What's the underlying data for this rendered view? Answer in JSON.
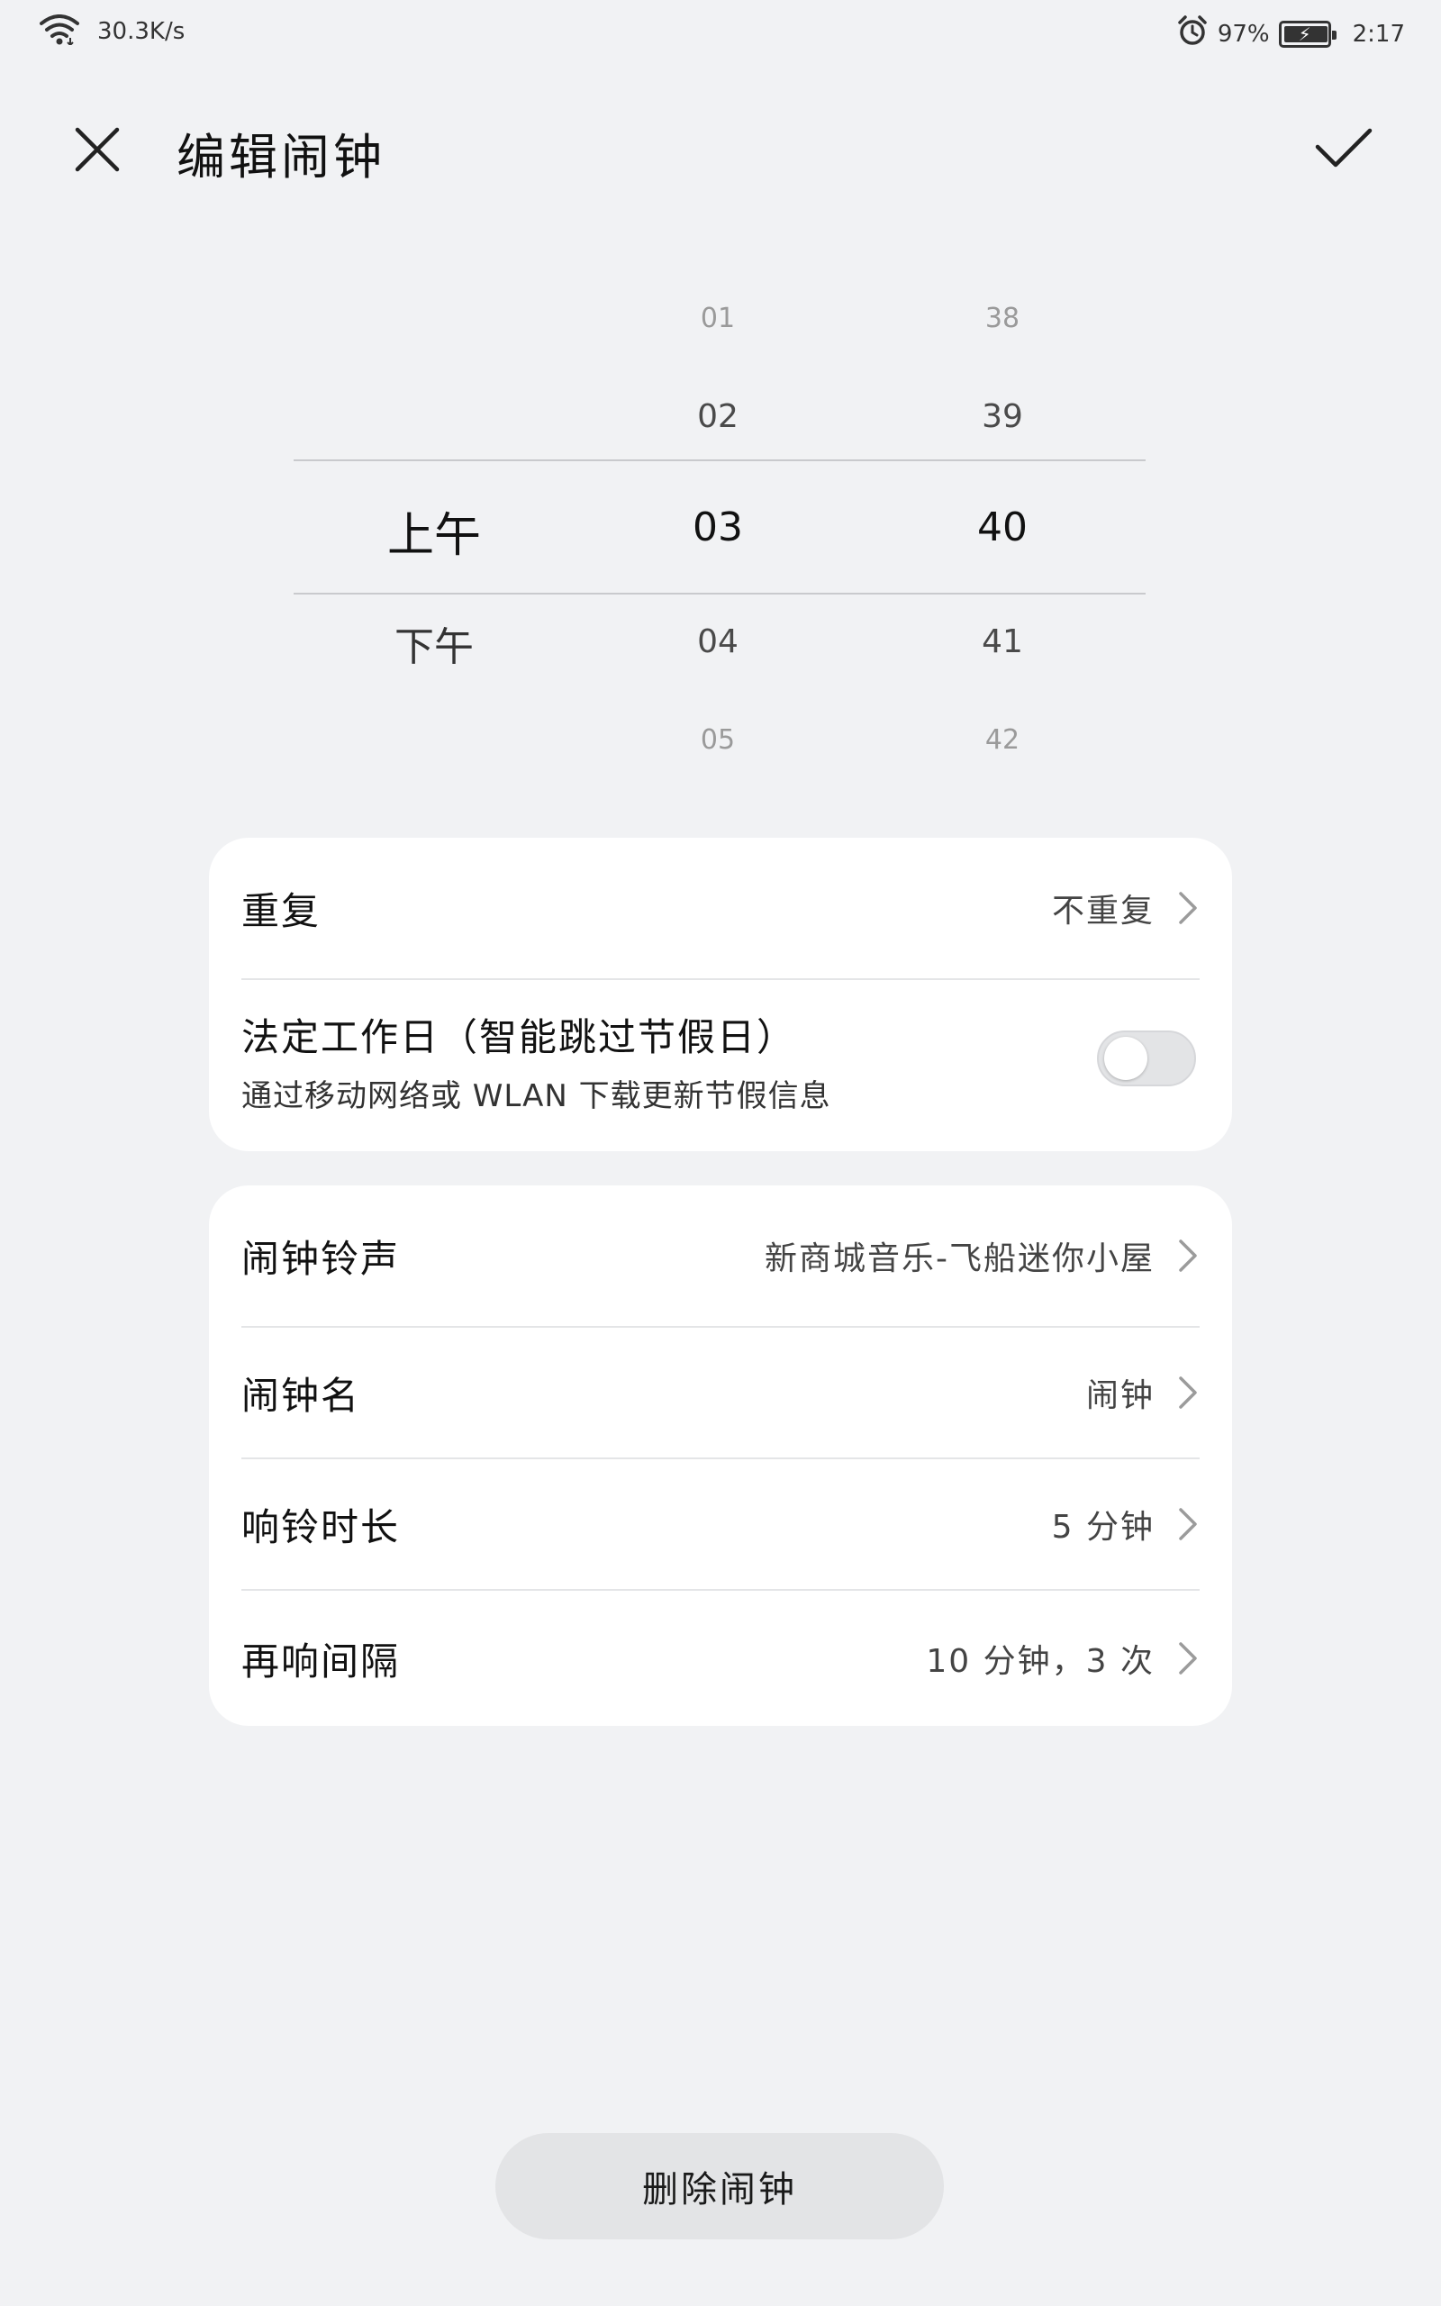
{
  "status_bar": {
    "network_speed": "30.3K/s",
    "battery_percent": "97%",
    "time": "2:17",
    "icons": [
      "wifi-icon",
      "alarm-icon",
      "battery-charging-icon"
    ]
  },
  "header": {
    "title": "编辑闹钟",
    "close_icon": "close-icon",
    "confirm_icon": "check-icon"
  },
  "picker": {
    "ampm": [
      "上午",
      "下午"
    ],
    "hours": [
      "01",
      "02",
      "03",
      "04",
      "05"
    ],
    "minutes": [
      "38",
      "39",
      "40",
      "41",
      "42"
    ],
    "selected_ampm": "上午",
    "selected_hour": "03",
    "selected_minute": "40"
  },
  "repeat_card": {
    "repeat_label": "重复",
    "repeat_value": "不重复",
    "workday_label": "法定工作日（智能跳过节假日）",
    "workday_sub": "通过移动网络或 WLAN 下载更新节假信息",
    "workday_enabled": false
  },
  "settings_card": {
    "rows": [
      {
        "label": "闹钟铃声",
        "value": "新商城音乐-飞船迷你小屋"
      },
      {
        "label": "闹钟名",
        "value": "闹钟"
      },
      {
        "label": "响铃时长",
        "value": "5 分钟"
      },
      {
        "label": "再响间隔",
        "value": "10 分钟，3 次"
      }
    ]
  },
  "delete_button": "删除闹钟",
  "colors": {
    "background": "#f1f2f4",
    "card": "#ffffff",
    "toggle_off": "#e3e4e6"
  }
}
